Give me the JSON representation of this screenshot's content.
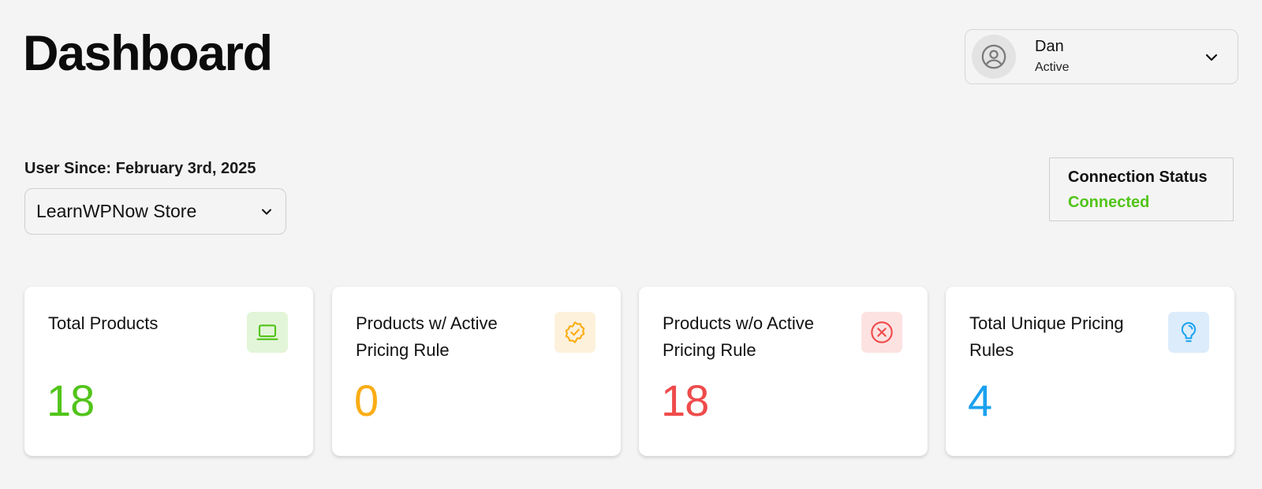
{
  "header": {
    "title": "Dashboard"
  },
  "user": {
    "name": "Dan",
    "status": "Active",
    "avatar_icon": "user-circle-icon",
    "menu_icon": "chevron-down-icon"
  },
  "account": {
    "user_since": "User Since: February 3rd, 2025",
    "store_select": {
      "selected": "LearnWPNow Store",
      "icon": "chevron-down-icon"
    }
  },
  "connection": {
    "label": "Connection Status",
    "value": "Connected",
    "color": "#52c41a"
  },
  "stats": [
    {
      "title": "Total Products",
      "value": "18",
      "color": "#52c41a",
      "icon": "laptop-icon",
      "icon_bg": "#e3f5d8"
    },
    {
      "title": "Products w/ Active Pricing Rule",
      "value": "0",
      "color": "#faad14",
      "icon": "badge-check-icon",
      "icon_bg": "#fdf1dc"
    },
    {
      "title": "Products w/o Active Pricing Rule",
      "value": "18",
      "color": "#ef4b4b",
      "icon": "x-circle-icon",
      "icon_bg": "#fde2e2"
    },
    {
      "title": "Total Unique Pricing Rules",
      "value": "4",
      "color": "#1aa1f0",
      "icon": "lightbulb-icon",
      "icon_bg": "#dcecfb"
    }
  ]
}
